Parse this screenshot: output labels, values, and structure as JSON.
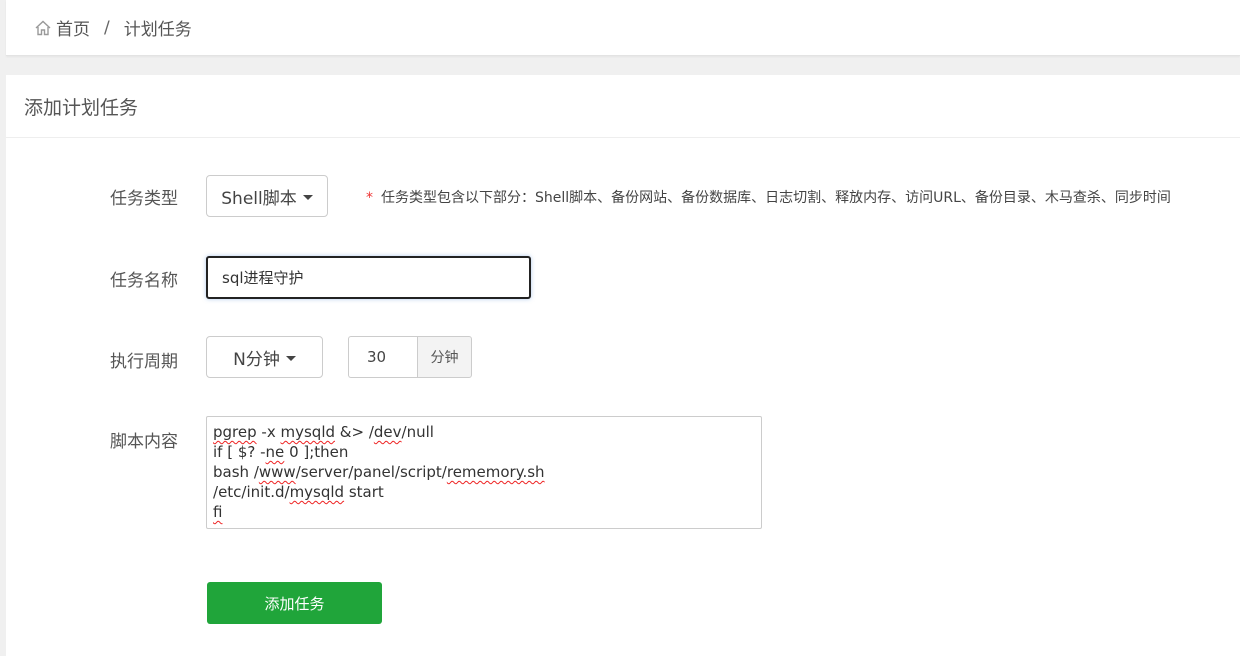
{
  "breadcrumb": {
    "home_icon": "home-icon",
    "home": "首页",
    "separator": "/",
    "current": "计划任务"
  },
  "panel": {
    "title": "添加计划任务"
  },
  "form": {
    "task_type": {
      "label": "任务类型",
      "selected": "Shell脚本",
      "hint_star": "*",
      "hint": "任务类型包含以下部分：Shell脚本、备份网站、备份数据库、日志切割、释放内存、访问URL、备份目录、木马查杀、同步时间"
    },
    "task_name": {
      "label": "任务名称",
      "value": "sql进程守护"
    },
    "period": {
      "label": "执行周期",
      "selected": "N分钟",
      "value": "30",
      "unit": "分钟"
    },
    "script": {
      "label": "脚本内容",
      "lines": [
        "pgrep -x mysqld &> /dev/null",
        "if [ $? -ne 0 ];then",
        "bash /www/server/panel/script/rememory.sh",
        "/etc/init.d/mysqld start",
        "fi"
      ]
    },
    "submit_label": "添加任务"
  },
  "colors": {
    "primary_green": "#20a53a",
    "required_star": "#e33333",
    "spellcheck_underline": "#e22222"
  }
}
